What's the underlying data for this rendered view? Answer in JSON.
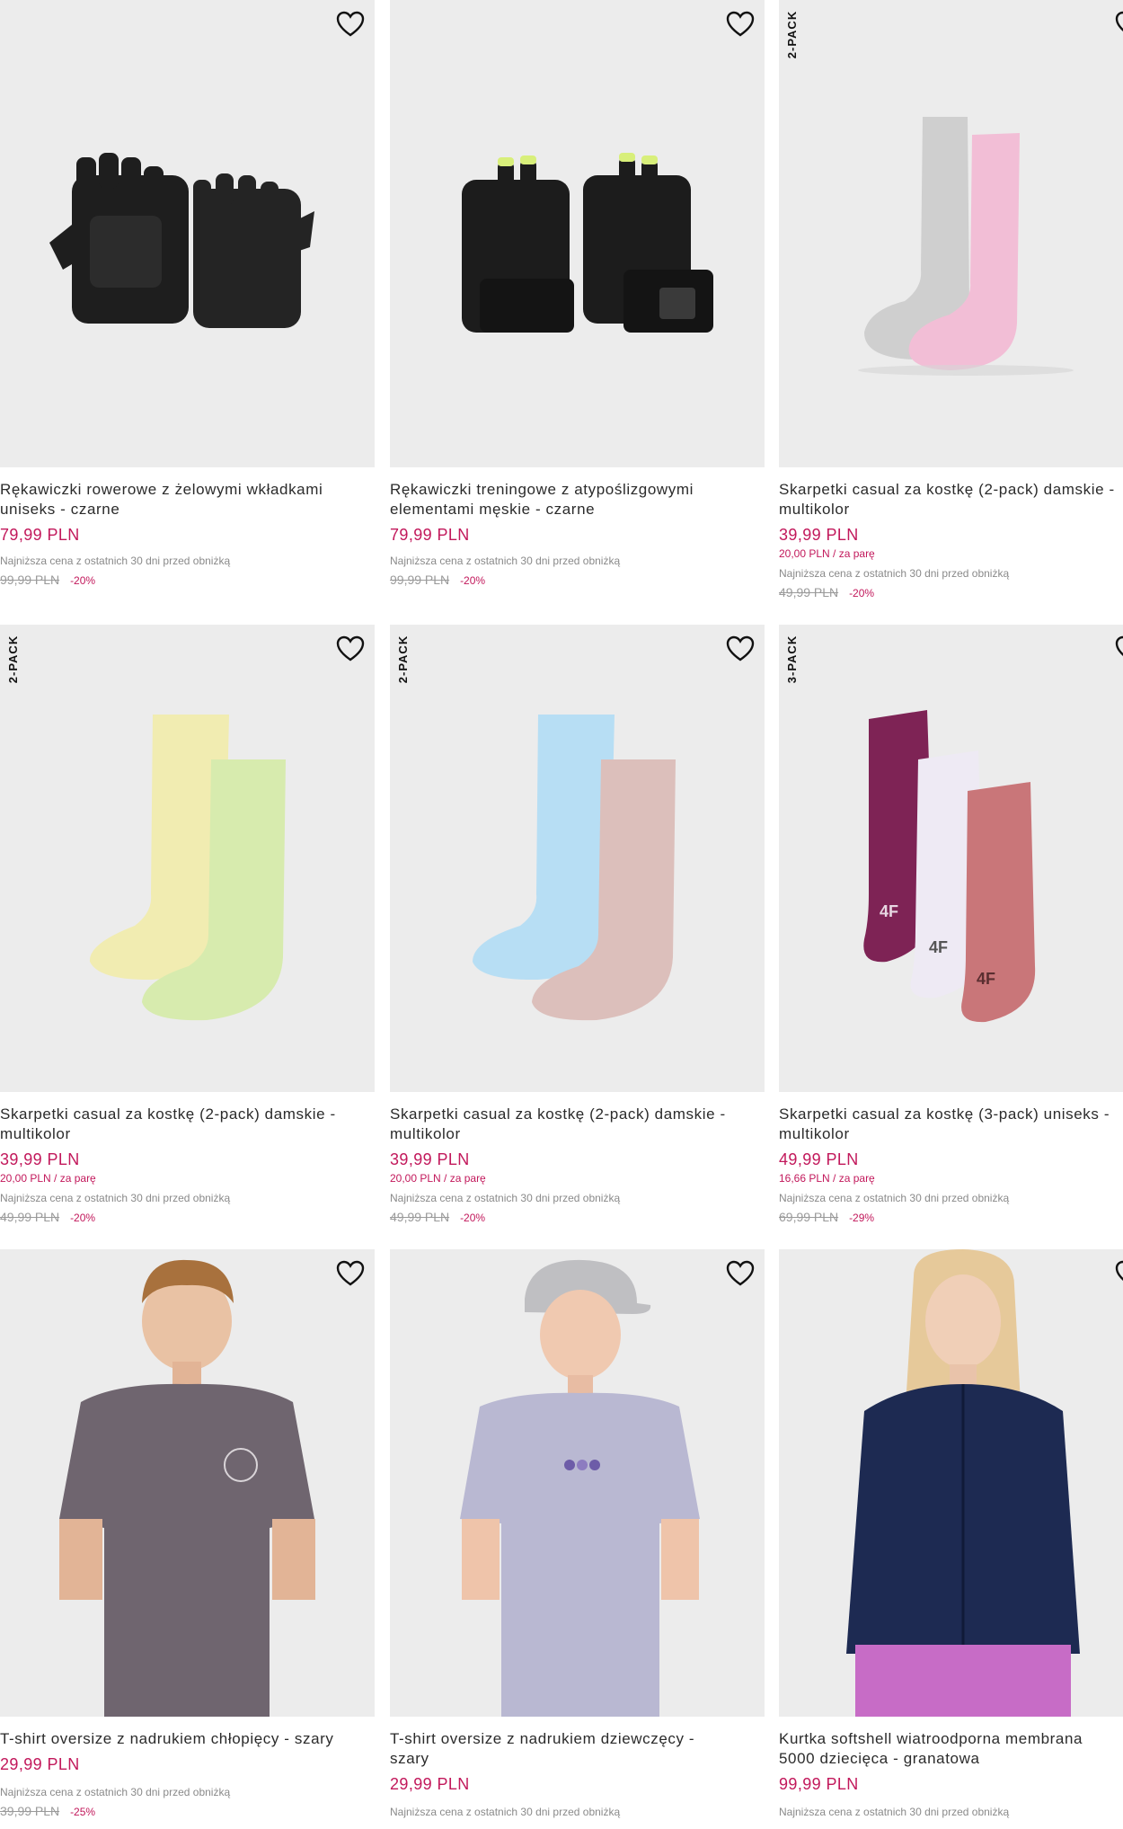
{
  "products": [
    {
      "name_l1": "Rękawiczki rowerowe z żelowymi wkładkami",
      "name_l2": "uniseks - czarne",
      "price": "79,99 PLN",
      "unit_price": "",
      "lowest_label": "Najniższa cena z ostatnich 30 dni przed obniżką",
      "old_price": "99,99 PLN",
      "discount": "-20%",
      "badge": "",
      "image": "black-cycling-gloves"
    },
    {
      "name_l1": "Rękawiczki treningowe z atypoślizgowymi",
      "name_l2": "elementami męskie - czarne",
      "price": "79,99 PLN",
      "unit_price": "",
      "lowest_label": "Najniższa cena z ostatnich 30 dni przed obniżką",
      "old_price": "99,99 PLN",
      "discount": "-20%",
      "badge": "",
      "image": "black-training-gloves"
    },
    {
      "name_l1": "Skarpetki casual za kostkę (2-pack) damskie -",
      "name_l2": "multikolor",
      "price": "39,99 PLN",
      "unit_price": "20,00 PLN / za parę",
      "lowest_label": "Najniższa cena z ostatnich 30 dni przed obniżką",
      "old_price": "49,99 PLN",
      "discount": "-20%",
      "badge": "2-PACK",
      "image": "grey-pink-socks"
    },
    {
      "name_l1": "Skarpetki casual za kostkę (2-pack) damskie -",
      "name_l2": "multikolor",
      "price": "39,99 PLN",
      "unit_price": "20,00 PLN / za parę",
      "lowest_label": "Najniższa cena z ostatnich 30 dni przed obniżką",
      "old_price": "49,99 PLN",
      "discount": "-20%",
      "badge": "2-PACK",
      "image": "yellow-green-socks"
    },
    {
      "name_l1": "Skarpetki casual za kostkę (2-pack) damskie -",
      "name_l2": "multikolor",
      "price": "39,99 PLN",
      "unit_price": "20,00 PLN / za parę",
      "lowest_label": "Najniższa cena z ostatnich 30 dni przed obniżką",
      "old_price": "49,99 PLN",
      "discount": "-20%",
      "badge": "2-PACK",
      "image": "blue-pink-socks"
    },
    {
      "name_l1": "Skarpetki casual za kostkę (3-pack) uniseks -",
      "name_l2": "multikolor",
      "price": "49,99 PLN",
      "unit_price": "16,66 PLN / za parę",
      "lowest_label": "Najniższa cena z ostatnich 30 dni przed obniżką",
      "old_price": "69,99 PLN",
      "discount": "-29%",
      "badge": "3-PACK",
      "image": "plum-white-rose-socks"
    },
    {
      "name_l1": "T-shirt oversize z nadrukiem chłopięcy - szary",
      "name_l2": "",
      "price": "29,99 PLN",
      "unit_price": "",
      "lowest_label": "Najniższa cena z ostatnich 30 dni przed obniżką",
      "old_price": "39,99 PLN",
      "discount": "-25%",
      "badge": "",
      "image": "boy-grey-tshirt"
    },
    {
      "name_l1": "T-shirt oversize z nadrukiem dziewczęcy -",
      "name_l2": "szary",
      "price": "29,99 PLN",
      "unit_price": "",
      "lowest_label": "Najniższa cena z ostatnich 30 dni przed obniżką",
      "old_price": "",
      "discount": "",
      "badge": "",
      "image": "girl-lilac-tshirt"
    },
    {
      "name_l1": "Kurtka softshell wiatroodporna membrana",
      "name_l2": "5000 dziecięca - granatowa",
      "price": "99,99 PLN",
      "unit_price": "",
      "lowest_label": "Najniższa cena z ostatnich 30 dni przed obniżką",
      "old_price": "",
      "discount": "",
      "badge": "",
      "image": "girl-navy-softshell"
    }
  ],
  "colors": {
    "price": "#c2185b",
    "image_bg": "#ececec"
  },
  "icons": {
    "favorite": "heart-outline-icon"
  }
}
